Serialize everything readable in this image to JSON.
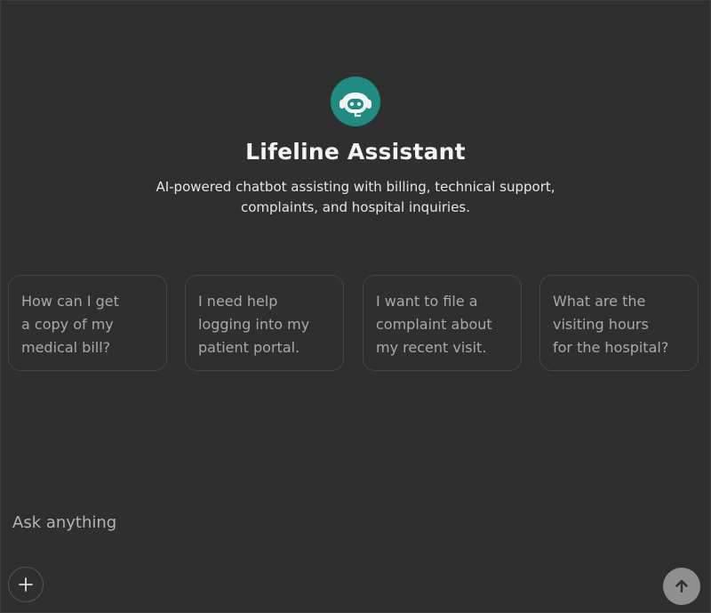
{
  "app": {
    "name": "Lifeline Assistant",
    "description": "AI-powered chatbot assisting with billing, technical support, complaints, and hospital inquiries.",
    "logo_icon": "robot-headset-icon",
    "accent": "#1f8c83"
  },
  "suggestions": [
    {
      "lines": [
        "How can I get",
        "a copy of my",
        "medical bill?"
      ]
    },
    {
      "lines": [
        "I need help",
        "logging into my",
        "patient portal."
      ]
    },
    {
      "lines": [
        "I want to file a",
        "complaint about",
        "my recent visit."
      ]
    },
    {
      "lines": [
        "What are the",
        "visiting hours",
        "for the hospital?"
      ]
    }
  ],
  "composer": {
    "placeholder": "Ask anything",
    "add_icon": "plus-icon",
    "send_icon": "arrow-up-icon"
  }
}
